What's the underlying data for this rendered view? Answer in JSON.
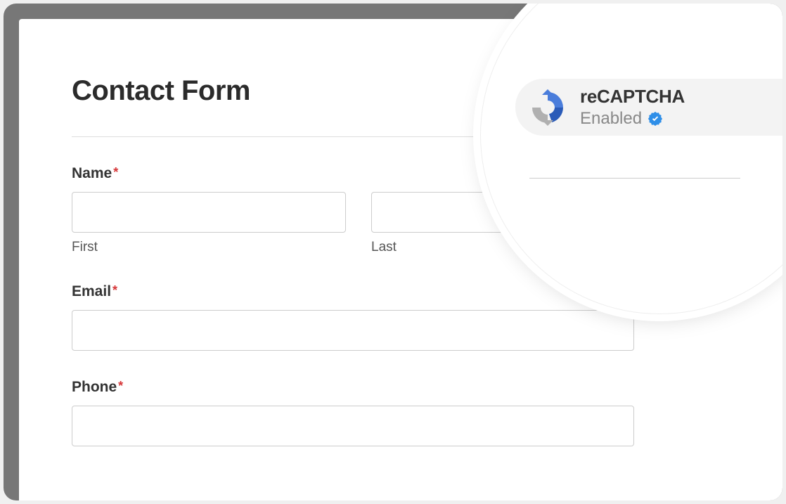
{
  "form": {
    "title": "Contact Form",
    "fields": {
      "name": {
        "label": "Name",
        "first_sub": "First",
        "last_sub": "Last",
        "first_value": "",
        "last_value": ""
      },
      "email": {
        "label": "Email",
        "value": ""
      },
      "phone": {
        "label": "Phone",
        "value": ""
      }
    },
    "required_marker": "*"
  },
  "recaptcha": {
    "title": "reCAPTCHA",
    "status": "Enabled"
  }
}
